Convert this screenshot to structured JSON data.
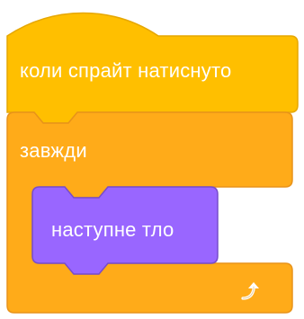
{
  "script": {
    "hat_block": {
      "label": "коли спрайт натиснуто",
      "category": "events",
      "color": "#FFBF00",
      "stroke": "#E6A700"
    },
    "forever_block": {
      "label": "завжди",
      "category": "control",
      "color": "#FFAB19",
      "stroke": "#E8931A",
      "loop_icon": "loop-arrow-icon"
    },
    "looks_block": {
      "label": "наступне тло",
      "category": "looks",
      "color": "#9966FF",
      "stroke": "#774DCB"
    }
  }
}
